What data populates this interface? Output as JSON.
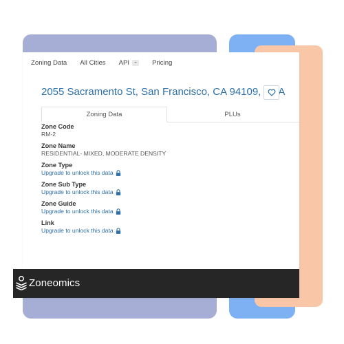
{
  "nav": {
    "items": [
      {
        "label": "Zoning Data"
      },
      {
        "label": "All Cities"
      },
      {
        "label": "API"
      },
      {
        "label": "Pricing"
      }
    ]
  },
  "property": {
    "address": "2055 Sacramento St, San Francisco, CA 94109, USA"
  },
  "tabs": [
    {
      "label": "Zoning Data",
      "active": true
    },
    {
      "label": "PLUs",
      "active": false
    }
  ],
  "fields": {
    "zone_code": {
      "label": "Zone Code",
      "value": "RM-2"
    },
    "zone_name": {
      "label": "Zone Name",
      "value": "RESIDENTIAL- MIXED, MODERATE DENSITY"
    },
    "zone_type": {
      "label": "Zone Type",
      "value": "Upgrade to unlock this data"
    },
    "zone_sub_type": {
      "label": "Zone Sub Type",
      "value": "Upgrade to unlock this data"
    },
    "zone_guide": {
      "label": "Zone Guide",
      "value": "Upgrade to unlock this data"
    },
    "link": {
      "label": "Link",
      "value": "Upgrade to unlock this data"
    }
  },
  "footer": {
    "brand": "Zoneomics"
  },
  "colors": {
    "accent": "#2d6fa8",
    "footer_bg": "#262626",
    "bg_purple": "#a6aed5",
    "bg_blue": "#7eb1f3",
    "bg_peach": "#f9c7a7"
  },
  "icons": {
    "favorite": "heart-icon",
    "lock": "lock-icon",
    "dropdown": "chevron-down-icon",
    "logo": "zoneomics-logo-icon"
  }
}
